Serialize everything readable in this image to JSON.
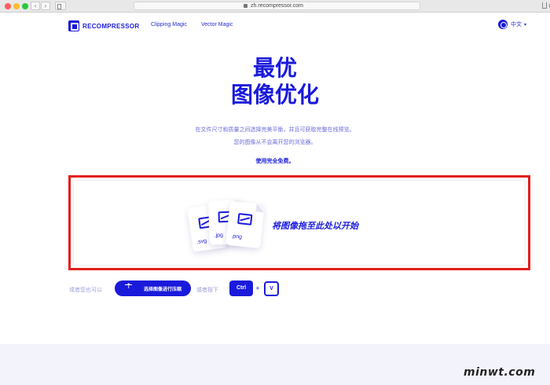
{
  "browser": {
    "url": "zh.recompressor.com",
    "back_glyph": "‹",
    "forward_glyph": "›",
    "reload_glyph": "↻"
  },
  "header": {
    "logo_text": "RECOMPRESSOR",
    "nav": [
      "Clipping Magic",
      "Vector Magic"
    ],
    "language": "中文",
    "chevron": "▾"
  },
  "hero": {
    "title_line1": "最优",
    "title_line2": "图像优化",
    "subtitle_line1": "在文件尺寸和质量之间选择完美平衡，并且可获取完整在线预览。",
    "subtitle_line2": "您的图像从不会离开您的浏览器。",
    "free_note": "使用完全免费。"
  },
  "dropzone": {
    "label": "将图像拖至此处以开始",
    "files": [
      ".svg",
      ".jpg",
      ".png"
    ]
  },
  "actions": {
    "or_text": "或者您也可以",
    "select_button": "选择图像进行压缩",
    "or_press": "或者按下",
    "key_ctrl": "Ctrl",
    "plus": "+",
    "key_v": "V"
  },
  "watermark": "minwt.com",
  "colors": {
    "brand": "#1a1adb",
    "highlight": "#e41d1d",
    "footer": "#f3f3fb"
  },
  "icons": [
    "logo-icon",
    "globe-icon",
    "upload-icon",
    "image-file-icon",
    "lock-icon"
  ]
}
